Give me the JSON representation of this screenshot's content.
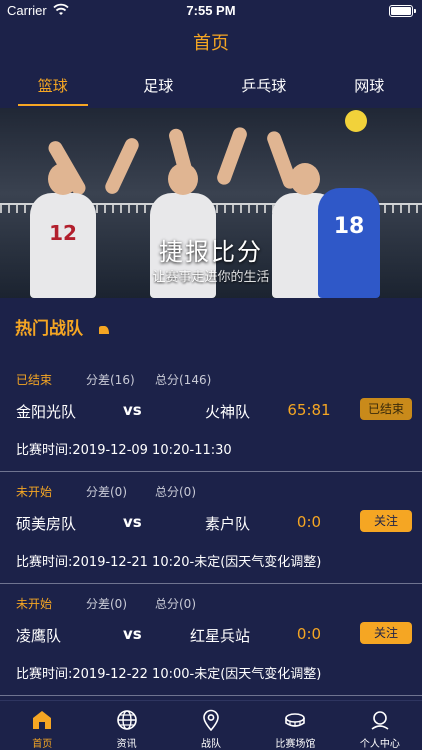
{
  "status_bar": {
    "carrier": "Carrier",
    "time": "7:55 PM"
  },
  "nav": {
    "title": "首页"
  },
  "tabs": [
    {
      "label": "篮球",
      "active": true
    },
    {
      "label": "足球",
      "active": false
    },
    {
      "label": "乒乓球",
      "active": false
    },
    {
      "label": "网球",
      "active": false
    }
  ],
  "banner": {
    "title": "捷报比分",
    "subtitle": "让赛事走进你的生活",
    "jersey_numbers": [
      "12",
      "18"
    ]
  },
  "section": {
    "title": "热门战队"
  },
  "matches": [
    {
      "status": "已结束",
      "diff": "分差(16)",
      "total": "总分(146)",
      "home": "金阳光队",
      "vs": "vs",
      "away": "火神队",
      "score": "65:81",
      "button": "已结束",
      "time": "比赛时间:2019-12-09 10:20-11:30"
    },
    {
      "status": "未开始",
      "diff": "分差(0)",
      "total": "总分(0)",
      "home": "硕美房队",
      "vs": "vs",
      "away": "素户队",
      "score": "0:0",
      "button": "关注",
      "time": "比赛时间:2019-12-21 10:20-未定(因天气变化调整)"
    },
    {
      "status": "未开始",
      "diff": "分差(0)",
      "total": "总分(0)",
      "home": "凌鹰队",
      "vs": "vs",
      "away": "红星兵站",
      "score": "0:0",
      "button": "关注",
      "time": "比赛时间:2019-12-22 10:00-未定(因天气变化调整)"
    }
  ],
  "tabbar": [
    {
      "label": "首页",
      "icon": "home-icon",
      "active": true
    },
    {
      "label": "资讯",
      "icon": "globe-icon",
      "active": false
    },
    {
      "label": "战队",
      "icon": "location-pin-icon",
      "active": false
    },
    {
      "label": "比赛场馆",
      "icon": "stadium-icon",
      "active": false
    },
    {
      "label": "个人中心",
      "icon": "person-icon",
      "active": false
    }
  ],
  "colors": {
    "background": "#1c2249",
    "accent": "#f5a623",
    "text": "#ffffff"
  }
}
